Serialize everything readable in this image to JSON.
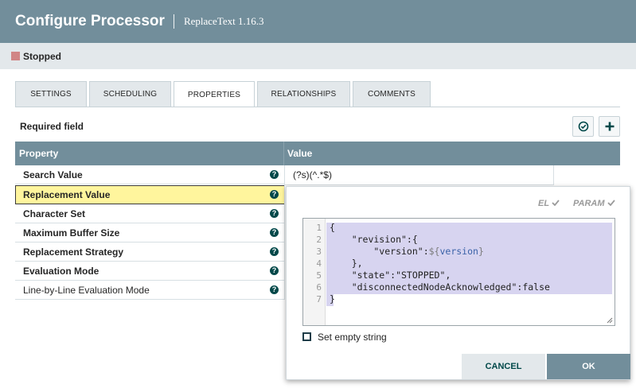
{
  "header": {
    "title": "Configure Processor",
    "subtitle": "ReplaceText 1.16.3"
  },
  "status": {
    "text": "Stopped",
    "color": "#d18686"
  },
  "tabs": [
    {
      "label": "SETTINGS"
    },
    {
      "label": "SCHEDULING"
    },
    {
      "label": "PROPERTIES",
      "active": true
    },
    {
      "label": "RELATIONSHIPS"
    },
    {
      "label": "COMMENTS"
    }
  ],
  "properties_panel": {
    "required_label": "Required field",
    "verify_icon": "check-circle-icon",
    "add_icon": "plus-icon",
    "columns": {
      "property": "Property",
      "value": "Value"
    },
    "rows": [
      {
        "name": "Search Value",
        "value": "(?s)(^.*$)"
      },
      {
        "name": "Replacement Value",
        "value": "",
        "selected": true
      },
      {
        "name": "Character Set",
        "value": ""
      },
      {
        "name": "Maximum Buffer Size",
        "value": ""
      },
      {
        "name": "Replacement Strategy",
        "value": ""
      },
      {
        "name": "Evaluation Mode",
        "value": ""
      },
      {
        "name": "Line-by-Line Evaluation Mode",
        "value": "",
        "optional": true
      }
    ]
  },
  "editor": {
    "el_label": "EL",
    "param_label": "PARAM",
    "line_numbers": [
      "1",
      "2",
      "3",
      "4",
      "5",
      "6",
      "7"
    ],
    "code_lines": [
      "{",
      "    \"revision\":{",
      "        \"version\":",
      "    },",
      "    \"state\":\"STOPPED\",",
      "    \"disconnectedNodeAcknowledged\":false",
      "}"
    ],
    "el_open": "${",
    "el_var": "version",
    "el_close": "}",
    "empty_string_label": "Set empty string",
    "cancel_label": "CANCEL",
    "ok_label": "OK"
  },
  "colors": {
    "header": "#728e9b",
    "accent": "#004849",
    "selection": "#fff59d"
  }
}
